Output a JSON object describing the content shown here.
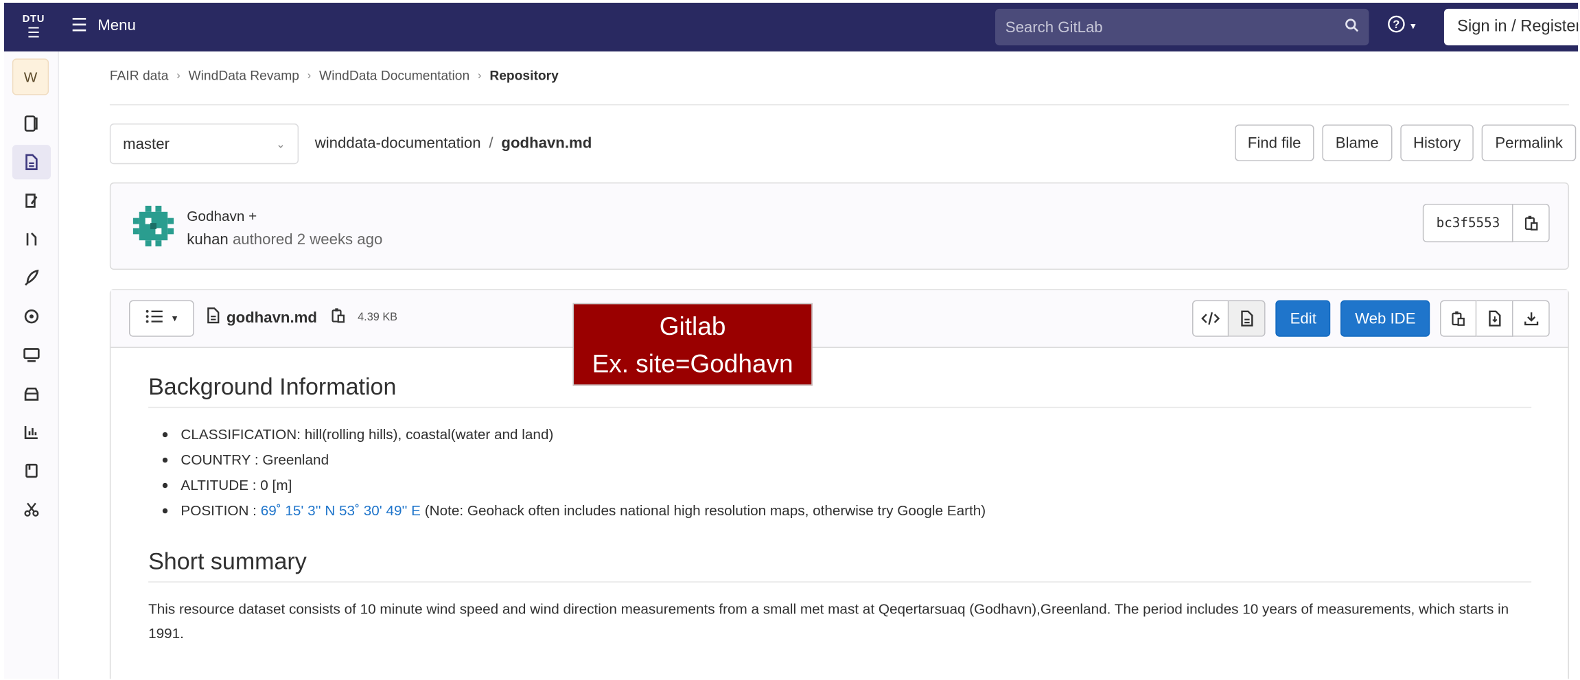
{
  "navbar": {
    "logo_text": "DTU",
    "menu_label": "Menu",
    "search_placeholder": "Search GitLab",
    "signin_label": "Sign in / Register"
  },
  "sidebar": {
    "project_initial": "W",
    "items": [
      {
        "name": "project-overview"
      },
      {
        "name": "repository"
      },
      {
        "name": "issues"
      },
      {
        "name": "merge-requests"
      },
      {
        "name": "ci-cd"
      },
      {
        "name": "deployments"
      },
      {
        "name": "monitor"
      },
      {
        "name": "packages"
      },
      {
        "name": "analytics"
      },
      {
        "name": "wiki"
      },
      {
        "name": "snippets"
      }
    ]
  },
  "breadcrumb": {
    "items": [
      "FAIR data",
      "WindData Revamp",
      "WindData Documentation"
    ],
    "current": "Repository"
  },
  "file_nav": {
    "branch": "master",
    "repo": "winddata-documentation",
    "separator": "/",
    "file": "godhavn.md",
    "buttons": [
      "Find file",
      "Blame",
      "History",
      "Permalink"
    ]
  },
  "commit": {
    "title": "Godhavn +",
    "author": "kuhan",
    "authored_text": "authored 2 weeks ago",
    "sha": "bc3f5553"
  },
  "file_header": {
    "name": "godhavn.md",
    "size": "4.39 KB",
    "edit_label": "Edit",
    "webide_label": "Web IDE"
  },
  "overlay": {
    "line1": "Gitlab",
    "line2": "Ex. site=Godhavn"
  },
  "content": {
    "heading1": "Background Information",
    "bullets": {
      "classification": "CLASSIFICATION: hill(rolling hills), coastal(water and land)",
      "country": "COUNTRY : Greenland",
      "altitude": "ALTITUDE : 0 [m]",
      "position_prefix": "POSITION : ",
      "position_link": "69˚ 15' 3'' N 53˚ 30' 49'' E",
      "position_note": " (Note: Geohack often includes national high resolution maps, otherwise try Google Earth)"
    },
    "heading2": "Short summary",
    "summary": "This resource dataset consists of 10 minute wind speed and wind direction measurements from a small met mast at Qeqertarsuaq (Godhavn),Greenland. The period includes 10 years of measurements, which starts in 1991."
  }
}
